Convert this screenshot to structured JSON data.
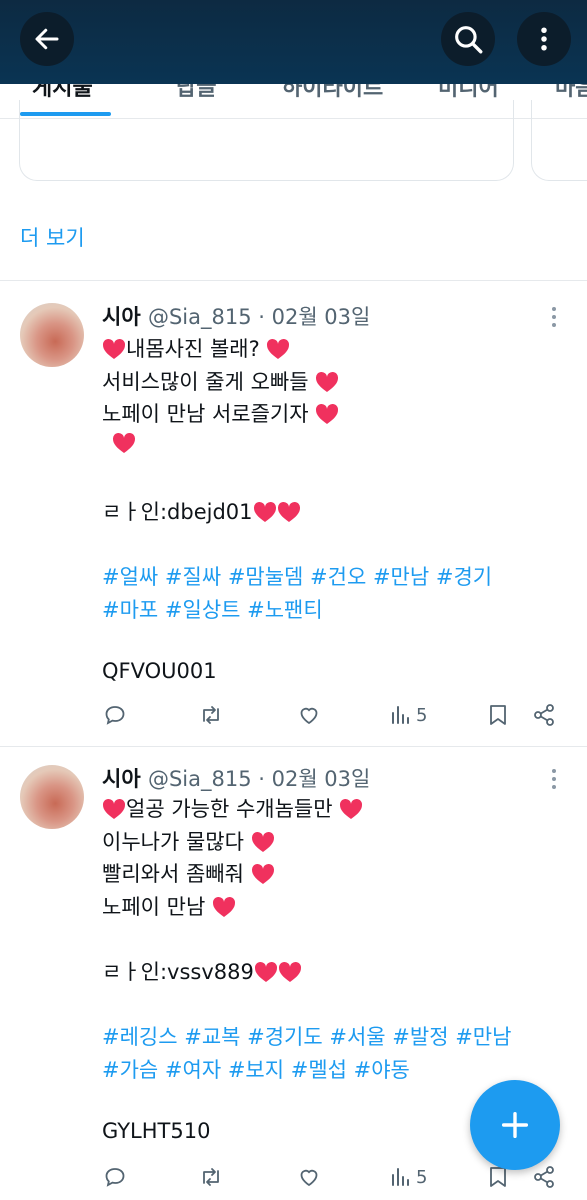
{
  "header": {
    "back_icon": "arrow-left-icon",
    "search_icon": "search-icon",
    "more_icon": "more-vertical-icon"
  },
  "tabs": [
    {
      "label": "게시물",
      "active": true
    },
    {
      "label": "답글"
    },
    {
      "label": "하이라이트"
    },
    {
      "label": "미디어"
    },
    {
      "label": "마음"
    }
  ],
  "show_more": "더 보기",
  "colors": {
    "accent": "#1d9bf0",
    "heart": "#f0315e",
    "header": "#0b2f4b"
  },
  "tweets": [
    {
      "name": "시아",
      "handle": "@Sia_815 · 02월 03일",
      "lines": [
        {
          "text": "내몸사진 볼래?",
          "lead_heart": true,
          "trail_hearts": 1
        },
        {
          "text": "서비스많이 줄게 오빠들",
          "trail_hearts": 1
        },
        {
          "text": "노페이 만남 서로즐기자",
          "trail_hearts": 1
        },
        {
          "text": "",
          "lead_heart": true
        },
        {
          "text": ""
        },
        {
          "text": "ㄹㅏ인:dbejd01",
          "trail_hearts": 2
        },
        {
          "text": ""
        },
        {
          "text": "#얼싸 #질싸 #맘눌뎀 #건오 #만남 #경기",
          "tags": true
        },
        {
          "text": "#마포 #일상트 #노팬티",
          "tags": true
        },
        {
          "text": ""
        },
        {
          "text": "QFVOU001"
        }
      ],
      "views": "5"
    },
    {
      "name": "시아",
      "handle": "@Sia_815 · 02월 03일",
      "lines": [
        {
          "text": "얼공 가능한 수개놈들만",
          "lead_heart": true,
          "trail_hearts": 1
        },
        {
          "text": "이누나가 물많다",
          "trail_hearts": 1
        },
        {
          "text": "빨리와서 좀빼줘",
          "trail_hearts": 1
        },
        {
          "text": "노페이 만남",
          "trail_hearts": 1
        },
        {
          "text": ""
        },
        {
          "text": "ㄹㅏ인:vssv889",
          "trail_hearts": 2
        },
        {
          "text": ""
        },
        {
          "text": "#레깅스 #교복 #경기도 #서울 #발정 #만남",
          "tags": true
        },
        {
          "text": "#가슴 #여자 #보지 #멜섭 #야동",
          "tags": true
        },
        {
          "text": ""
        },
        {
          "text": "GYLHT510"
        }
      ],
      "views": "5"
    }
  ],
  "fab_icon": "plus-icon"
}
